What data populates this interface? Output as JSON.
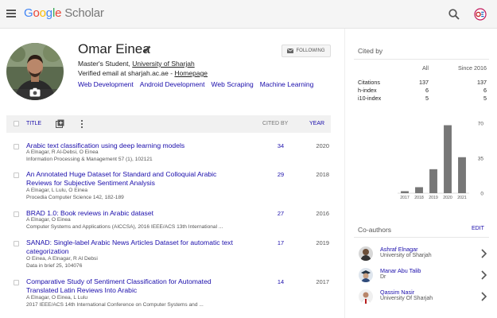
{
  "header": {
    "logo_google": [
      "G",
      "o",
      "o",
      "g",
      "l",
      "e"
    ],
    "logo_scholar": "Scholar",
    "icons": {
      "menu": "menu-icon",
      "search": "search-icon",
      "account": "account-icon"
    }
  },
  "profile": {
    "name": "Omar Einea",
    "affiliation_prefix": "Master's Student, ",
    "affiliation_link": "University of Sharjah",
    "email_prefix": "Verified email at sharjah.ac.ae - ",
    "email_link": "Homepage",
    "follow_label": "FOLLOWING",
    "interests": [
      "Web Development",
      "Android Development",
      "Web Scraping",
      "Machine Learning"
    ]
  },
  "table": {
    "col_title": "TITLE",
    "col_cited_by": "CITED BY",
    "col_year": "YEAR"
  },
  "articles": [
    {
      "title": "Arabic text classification using deep learning models",
      "authors": "A Elnagar, R Al-Debsi, O Einea",
      "venue": "Information Processing & Management 57 (1), 102121",
      "cited_by": "34",
      "year": "2020"
    },
    {
      "title": "An Annotated Huge Dataset for Standard and Colloquial Arabic Reviews for Subjective Sentiment Analysis",
      "authors": "A Elnagar, L Lulu, O Einea",
      "venue": "Procedia Computer Science 142, 182-189",
      "cited_by": "29",
      "year": "2018"
    },
    {
      "title": "BRAD 1.0: Book reviews in Arabic dataset",
      "authors": "A Elnagar, O Einea",
      "venue": "Computer Systems and Applications (AICCSA), 2016 IEEE/ACS 13th International ...",
      "cited_by": "27",
      "year": "2016"
    },
    {
      "title": "SANAD: Single-label Arabic News Articles Dataset for automatic text categorization",
      "authors": "O Einea, A Elnagar, R Al Debsi",
      "venue": "Data in brief 25, 104076",
      "cited_by": "17",
      "year": "2019"
    },
    {
      "title": "Comparative Study of Sentiment Classification for Automated Translated Latin Reviews Into Arabic",
      "authors": "A Elnagar, O Einea, L Lulu",
      "venue": "2017 IEEE/ACS 14th International Conference on Computer Systems and ...",
      "cited_by": "14",
      "year": "2017"
    }
  ],
  "cited_by": {
    "title": "Cited by",
    "col_all": "All",
    "col_since": "Since 2016",
    "rows": [
      {
        "label": "Citations",
        "all": "137",
        "since": "137"
      },
      {
        "label": "h-index",
        "all": "6",
        "since": "6"
      },
      {
        "label": "i10-index",
        "all": "5",
        "since": "5"
      }
    ]
  },
  "chart_data": {
    "type": "bar",
    "categories": [
      "2017",
      "2018",
      "2019",
      "2020",
      "2021"
    ],
    "values": [
      2,
      6,
      24,
      68,
      36
    ],
    "ylim": [
      0,
      70
    ],
    "yticks": [
      "0",
      "35",
      "70"
    ],
    "bar_color": "#777777",
    "grid": false
  },
  "coauthors": {
    "title": "Co-authors",
    "edit_label": "EDIT",
    "items": [
      {
        "name": "Ashraf Elnagar",
        "affiliation": "University of Sharjah"
      },
      {
        "name": "Manar Abu Talib",
        "affiliation": "Dr"
      },
      {
        "name": "Qassim Nasir",
        "affiliation": "University Of Sharjah"
      }
    ]
  },
  "colors": {
    "link": "#1a0dab",
    "header_bg": "#f5f5f5",
    "table_header_bg": "#f1f1f1"
  }
}
